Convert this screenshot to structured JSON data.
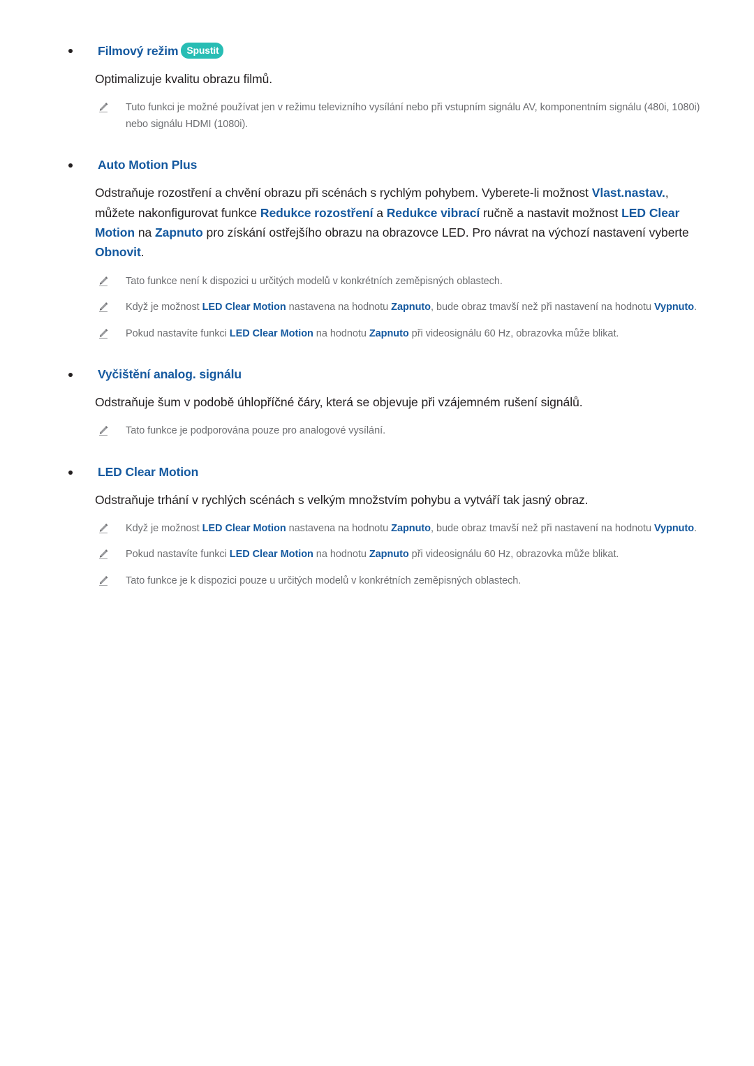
{
  "document": {
    "language": "cs",
    "colors": {
      "heading_blue": "#15599f",
      "highlight_blue": "#15599f",
      "body_text": "#231f20",
      "note_text": "#6d6e71",
      "badge_teal": "#28bdb4",
      "badge_text": "#ffffff",
      "background": "#ffffff"
    }
  },
  "sections": [
    {
      "id": "filmovy-rezim",
      "heading": "Filmový režim",
      "badge": "Spustit",
      "body": [
        {
          "text": "Optimalizuje kvalitu obrazu filmů."
        }
      ],
      "notes": [
        {
          "text": "Tuto funkci je možné používat jen v režimu televizního vysílání nebo při vstupním signálu AV, komponentním signálu (480i, 1080i) nebo signálu HDMI (1080i)."
        }
      ]
    },
    {
      "id": "auto-motion-plus",
      "heading": "Auto Motion Plus",
      "badge": null,
      "body": [
        {
          "parts": [
            {
              "t": "Odstraňuje rozostření a chvění obrazu při scénách s rychlým pohybem. Vyberete-li možnost ",
              "hi": false
            },
            {
              "t": "Vlast.nastav.",
              "hi": true
            },
            {
              "t": ", můžete nakonfigurovat funkce ",
              "hi": false
            },
            {
              "t": "Redukce rozostření",
              "hi": true
            },
            {
              "t": " a ",
              "hi": false
            },
            {
              "t": "Redukce vibrací",
              "hi": true
            },
            {
              "t": " ručně a nastavit možnost ",
              "hi": false
            },
            {
              "t": "LED Clear Motion",
              "hi": true
            },
            {
              "t": " na ",
              "hi": false
            },
            {
              "t": "Zapnuto",
              "hi": true
            },
            {
              "t": " pro získání ostřejšího obrazu na obrazovce LED. Pro návrat na výchozí nastavení vyberte ",
              "hi": false
            },
            {
              "t": "Obnovit",
              "hi": true
            },
            {
              "t": ".",
              "hi": false
            }
          ]
        }
      ],
      "notes": [
        {
          "parts": [
            {
              "t": "Tato funkce není k dispozici u určitých modelů v konkrétních zeměpisných oblastech.",
              "hi": false
            }
          ]
        },
        {
          "parts": [
            {
              "t": "Když je možnost ",
              "hi": false
            },
            {
              "t": "LED Clear Motion",
              "hi": true
            },
            {
              "t": " nastavena na hodnotu ",
              "hi": false
            },
            {
              "t": "Zapnuto",
              "hi": true
            },
            {
              "t": ", bude obraz tmavší než při nastavení na hodnotu ",
              "hi": false
            },
            {
              "t": "Vypnuto",
              "hi": true
            },
            {
              "t": ".",
              "hi": false
            }
          ]
        },
        {
          "parts": [
            {
              "t": "Pokud nastavíte funkci ",
              "hi": false
            },
            {
              "t": "LED Clear Motion",
              "hi": true
            },
            {
              "t": " na hodnotu ",
              "hi": false
            },
            {
              "t": "Zapnuto",
              "hi": true
            },
            {
              "t": " při videosignálu 60 Hz, obrazovka může blikat.",
              "hi": false
            }
          ]
        }
      ]
    },
    {
      "id": "vycisteni-analog-signalu",
      "heading": "Vyčištění analog. signálu",
      "badge": null,
      "body": [
        {
          "text": "Odstraňuje šum v podobě úhlopříčné čáry, která se objevuje při vzájemném rušení signálů."
        }
      ],
      "notes": [
        {
          "text": "Tato funkce je podporována pouze pro analogové vysílání."
        }
      ]
    },
    {
      "id": "led-clear-motion",
      "heading": "LED Clear Motion",
      "badge": null,
      "body": [
        {
          "text": "Odstraňuje trhání v rychlých scénách s velkým množstvím pohybu a vytváří tak jasný obraz."
        }
      ],
      "notes": [
        {
          "parts": [
            {
              "t": "Když je možnost ",
              "hi": false
            },
            {
              "t": "LED Clear Motion",
              "hi": true
            },
            {
              "t": " nastavena na hodnotu ",
              "hi": false
            },
            {
              "t": "Zapnuto",
              "hi": true
            },
            {
              "t": ", bude obraz tmavší než při nastavení na hodnotu ",
              "hi": false
            },
            {
              "t": "Vypnuto",
              "hi": true
            },
            {
              "t": ".",
              "hi": false
            }
          ]
        },
        {
          "parts": [
            {
              "t": "Pokud nastavíte funkci ",
              "hi": false
            },
            {
              "t": "LED Clear Motion",
              "hi": true
            },
            {
              "t": " na hodnotu ",
              "hi": false
            },
            {
              "t": "Zapnuto",
              "hi": true
            },
            {
              "t": " při videosignálu 60 Hz, obrazovka může blikat.",
              "hi": false
            }
          ]
        },
        {
          "parts": [
            {
              "t": "Tato funkce je k dispozici pouze u určitých modelů v konkrétních zeměpisných oblastech.",
              "hi": false
            }
          ]
        }
      ]
    }
  ],
  "icons": {
    "note": "pencil-icon",
    "bullet": "bullet-dot-icon"
  }
}
